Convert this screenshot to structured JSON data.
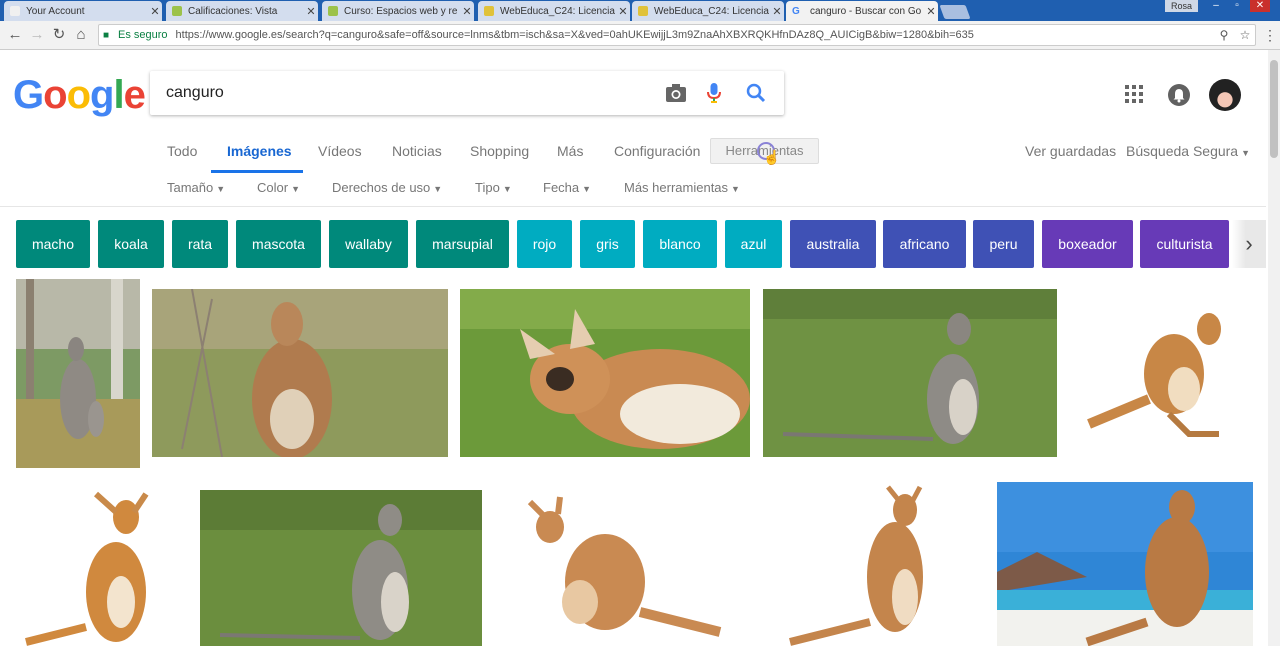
{
  "browser": {
    "tabs": [
      {
        "title": "Your Account",
        "favicon_color": "#f0f0f0",
        "active": false
      },
      {
        "title": "Calificaciones: Vista",
        "favicon_color": "#9cc24a",
        "active": false
      },
      {
        "title": "Curso: Espacios web y re",
        "favicon_color": "#9cc24a",
        "active": false
      },
      {
        "title": "WebEduca_C24: Licencia",
        "favicon_color": "#e0c23a",
        "active": false
      },
      {
        "title": "WebEduca_C24: Licencia",
        "favicon_color": "#e0c23a",
        "active": false
      },
      {
        "title": "canguro - Buscar con Go",
        "favicon_color": "#4285f4",
        "active": true
      }
    ],
    "window_user": "Rosa",
    "secure_label": "Es seguro",
    "url": "https://www.google.es/search?q=canguro&safe=off&source=lnms&tbm=isch&sa=X&ved=0ahUKEwijjL3m9ZnaAhXBXRQKHfnDAz8Q_AUICigB&biw=1280&bih=635"
  },
  "search": {
    "logo": "Google",
    "logo_colors": [
      "#4285f4",
      "#ea4335",
      "#fbbc05",
      "#4285f4",
      "#34a853",
      "#ea4335"
    ],
    "query": "canguro",
    "icons": [
      "camera-icon",
      "microphone-icon",
      "search-icon"
    ]
  },
  "tabs": {
    "todo": "Todo",
    "imagenes": "Imágenes",
    "videos": "Vídeos",
    "noticias": "Noticias",
    "shopping": "Shopping",
    "mas": "Más",
    "configuracion": "Configuración",
    "herramientas": "Herramientas"
  },
  "right_links": {
    "ver_guardadas": "Ver guardadas",
    "busqueda_segura": "Búsqueda Segura"
  },
  "filters": {
    "tamano": "Tamaño",
    "color": "Color",
    "derechos": "Derechos de uso",
    "tipo": "Tipo",
    "fecha": "Fecha",
    "mas_herramientas": "Más herramientas"
  },
  "chips": [
    {
      "label": "macho",
      "color": "#00897b"
    },
    {
      "label": "koala",
      "color": "#00897b"
    },
    {
      "label": "rata",
      "color": "#00897b"
    },
    {
      "label": "mascota",
      "color": "#00897b"
    },
    {
      "label": "wallaby",
      "color": "#00897b"
    },
    {
      "label": "marsupial",
      "color": "#00897b"
    },
    {
      "label": "rojo",
      "color": "#00acc1"
    },
    {
      "label": "gris",
      "color": "#00acc1"
    },
    {
      "label": "blanco",
      "color": "#00acc1"
    },
    {
      "label": "azul",
      "color": "#00acc1"
    },
    {
      "label": "australia",
      "color": "#3f51b5"
    },
    {
      "label": "africano",
      "color": "#3f51b5"
    },
    {
      "label": "peru",
      "color": "#3f51b5"
    },
    {
      "label": "boxeador",
      "color": "#673ab7"
    },
    {
      "label": "culturista",
      "color": "#673ab7"
    }
  ],
  "colors": {
    "accent": "#1a73e8",
    "tabbar": "#1f5fb0"
  }
}
